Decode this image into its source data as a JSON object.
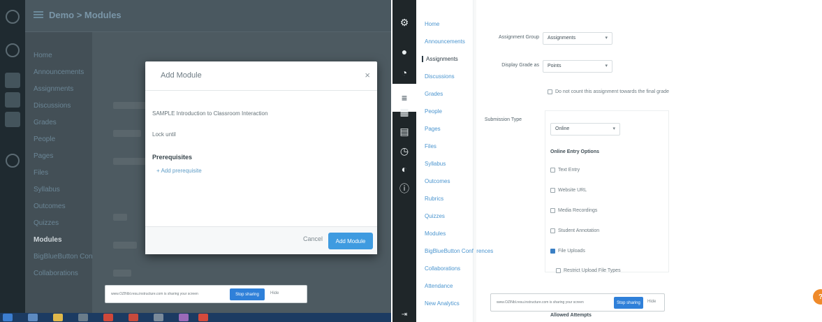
{
  "left": {
    "breadcrumb": "Demo > Modules",
    "course_nav": [
      "Home",
      "Announcements",
      "Assignments",
      "Discussions",
      "Grades",
      "People",
      "Pages",
      "Files",
      "Syllabus",
      "Outcomes",
      "Quizzes",
      "Modules",
      "BigBlueButton Conferences",
      "Collaborations"
    ],
    "active_index": 11,
    "modal": {
      "title": "Add Module",
      "close": "×",
      "module_name": "SAMPLE Introduction to Classroom Interaction",
      "lock_until": "Lock until",
      "prerequisites_label": "Prerequisites",
      "add_prerequisite": "+ Add prerequisite",
      "cancel": "Cancel",
      "add_button": "Add Module"
    },
    "share_bar": {
      "text": "www.OZINbl.resu.instructure.com is sharing your screen",
      "stop": "Stop sharing",
      "hide": "Hide"
    }
  },
  "right": {
    "global_nav_icons": [
      "gear-icon",
      "account-icon",
      "dashboard-icon",
      "courses-icon",
      "calendar-icon",
      "inbox-icon",
      "history-icon",
      "commons-icon",
      "help-icon",
      "collapse-icon"
    ],
    "course_nav": [
      "Home",
      "Announcements",
      "Assignments",
      "Discussions",
      "Grades",
      "People",
      "Pages",
      "Files",
      "Syllabus",
      "Outcomes",
      "Rubrics",
      "Quizzes",
      "Modules",
      "BigBlueButton Conferences",
      "Collaborations",
      "Attendance",
      "New Analytics"
    ],
    "active_index": 2,
    "form": {
      "assignment_group_label": "Assignment Group",
      "assignment_group_value": "Assignments",
      "display_grade_label": "Display Grade as",
      "display_grade_value": "Points",
      "final_grade_checkbox": "Do not count this assignment towards the final grade",
      "submission_type_label": "Submission Type",
      "submission_type_value": "Online",
      "online_entry_heading": "Online Entry Options",
      "options": [
        {
          "label": "Text Entry",
          "checked": false
        },
        {
          "label": "Website URL",
          "checked": false
        },
        {
          "label": "Media Recordings",
          "checked": false
        },
        {
          "label": "Student Annotation",
          "checked": false
        },
        {
          "label": "File Uploads",
          "checked": true
        }
      ],
      "restrict_label": "Restrict Upload File Types",
      "allowed_attempts": "Allowed Attempts"
    },
    "share_bar": {
      "text": "www.OZINbl.resu.instructure.com is sharing your screen",
      "stop": "Stop sharing",
      "hide": "Hide"
    },
    "help_badge": "?"
  }
}
